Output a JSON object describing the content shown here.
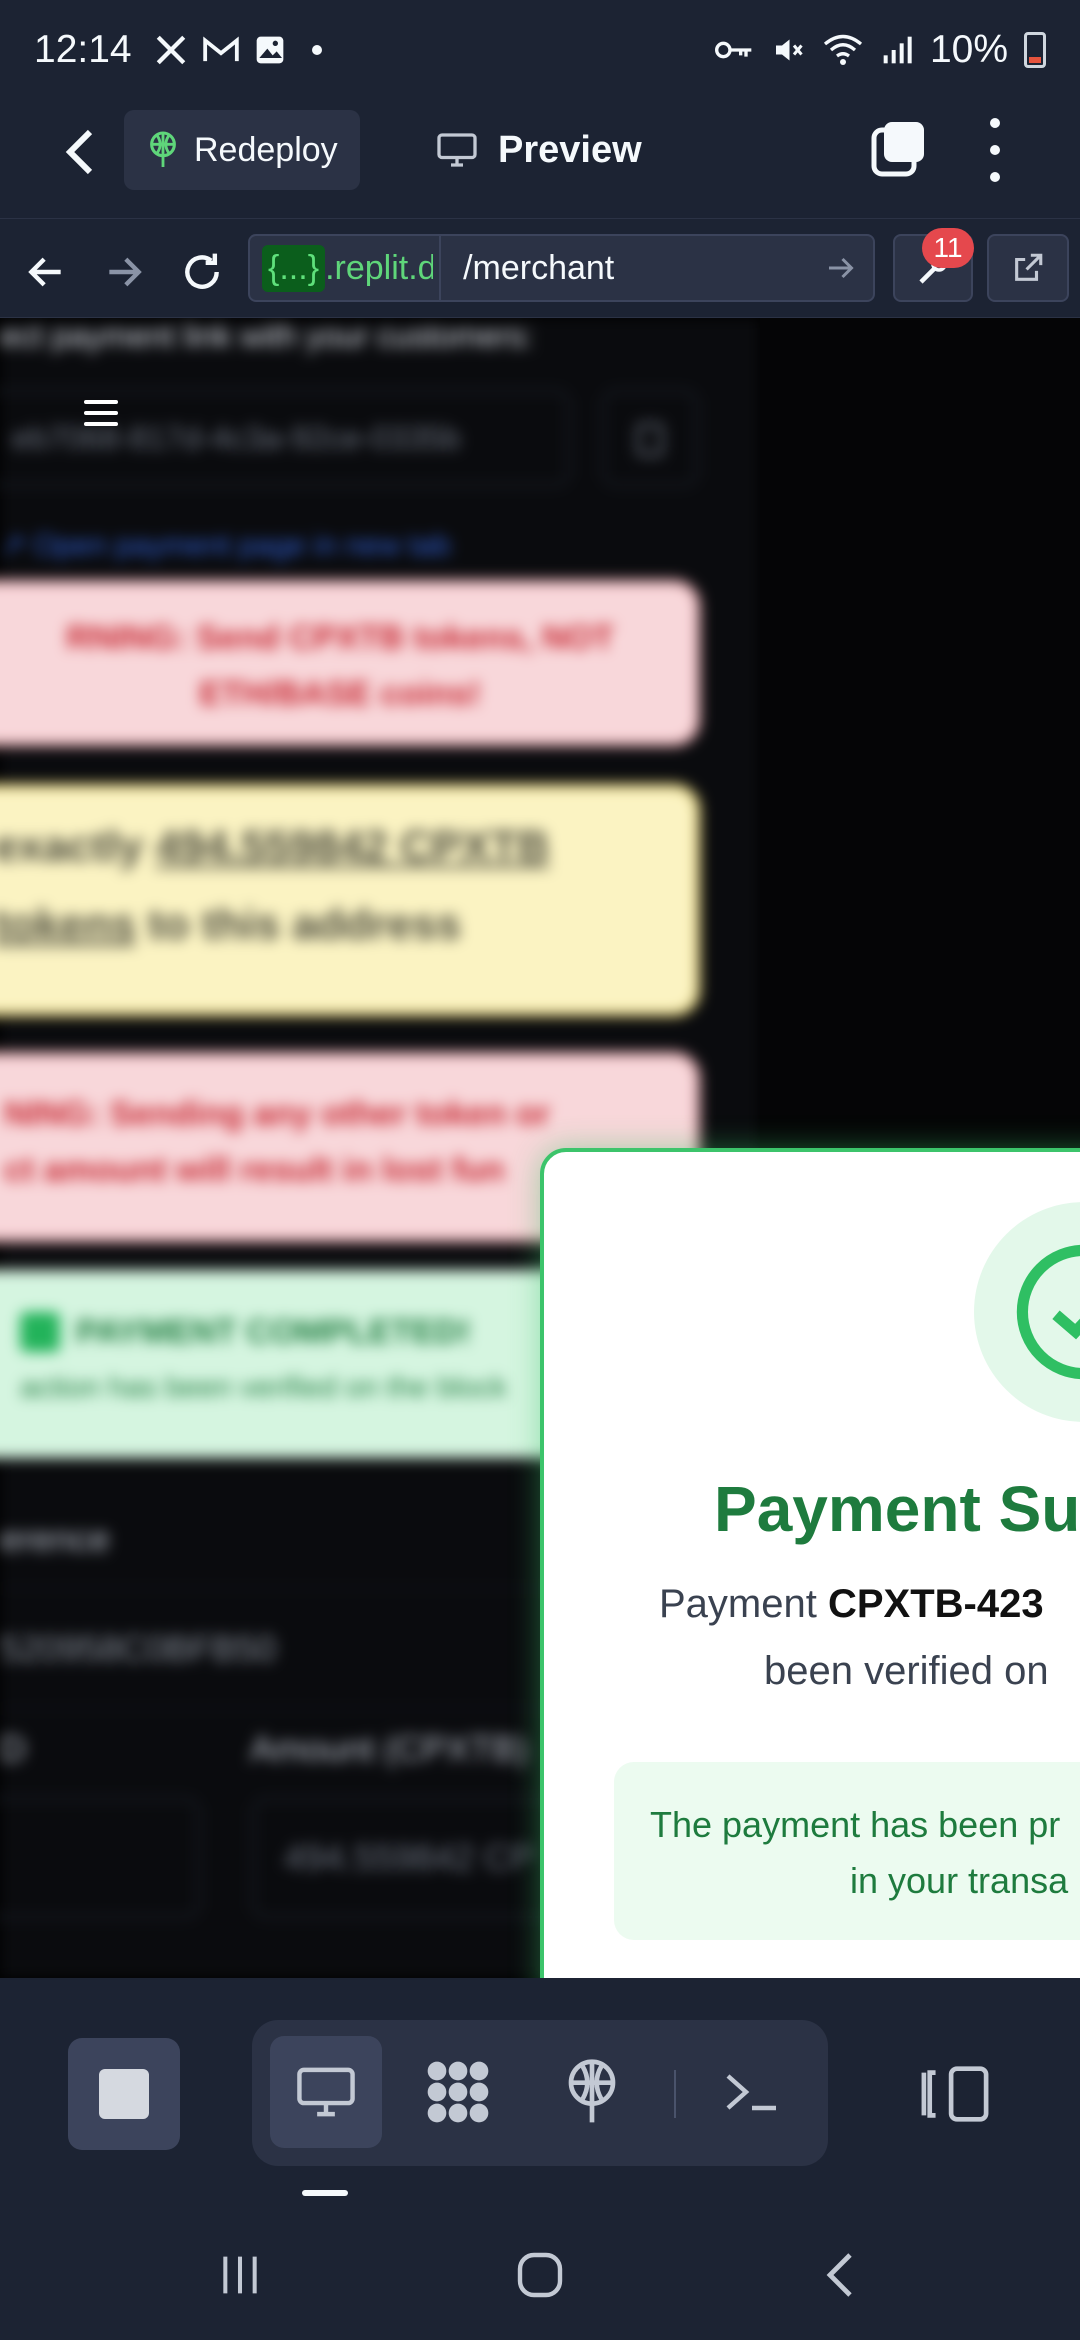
{
  "status_bar": {
    "time": "12:14",
    "notification_icons": [
      "x-icon",
      "gmail-icon",
      "gallery-icon",
      "dot-icon"
    ],
    "system_icons": [
      "vpn-key-icon",
      "mute-icon",
      "wifi-icon",
      "signal-icon"
    ],
    "battery": "10%",
    "battery_color": "#e5533d"
  },
  "toolbar": {
    "redeploy_label": "Redeploy",
    "preview_label": "Preview"
  },
  "browser": {
    "domain_badge": "{...}",
    "domain_text": ".replit.de",
    "path": "/merchant",
    "devtools_badge": "11",
    "badge_color": "#e5484d"
  },
  "page": {
    "intro_text": "ect payment link with your customers:",
    "payment_id": "eb7068-817d-4c3a-92ce-0335b",
    "open_link": "↗ Open payment page in new tab",
    "warning_1": "RNING: Send CPXTB tokens, NOT ETH/BASE coins!",
    "instruction_prefix": "exactly ",
    "instruction_amount": "494.559842 CPXTB",
    "instruction_tokens": "tokens",
    "instruction_suffix": " to this address",
    "warning_2_line1": "NING: Sending any other token or",
    "warning_2_line2": "ct amount will result in lost fun",
    "completed_title": "PAYMENT COMPLETED!",
    "completed_sub": "action has been verified on the block",
    "reference_label": "erence",
    "reference_value": "520958C0BFB50",
    "col_left_label": "D",
    "amount_label": "Amount (CPXTB)",
    "amount_value": "494.559842 CP"
  },
  "modal": {
    "title": "Payment Su",
    "line1_prefix": "Payment ",
    "line1_code": "CPXTB-423",
    "line2": "been verified on",
    "box_line1": "The payment has been pr",
    "box_line2": "in your transa",
    "accent_color": "#1e7b3e"
  },
  "bottom_bar": {
    "active_tab": "preview"
  }
}
